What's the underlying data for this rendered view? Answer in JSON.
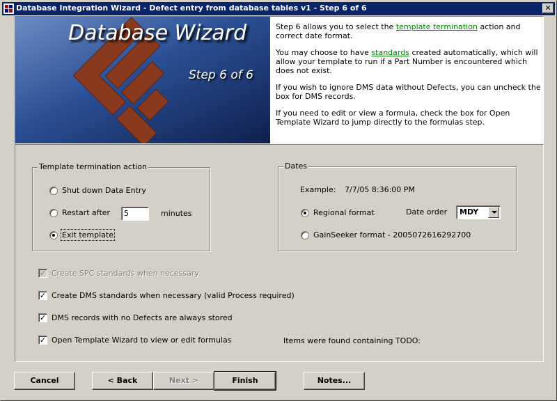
{
  "window": {
    "title": "Database Integration Wizard - Defect entry from database tables    v1 - Step 6 of 6",
    "close_glyph": "✕"
  },
  "banner": {
    "title": "Database Wizard",
    "step": "Step 6 of 6",
    "help": {
      "p1_pre": "Step 6 allows you to select the ",
      "p1_link": "template termination",
      "p1_post": " action and correct date format.",
      "p2_pre": "You may choose to have ",
      "p2_link": "standards",
      "p2_post": " created automatically, which will allow your template to run if a Part Number is encountered which does not exist.",
      "p3": "If you wish to ignore DMS data without Defects, you can uncheck the box for DMS records.",
      "p4": "If you need to edit or view a formula, check the box for Open Template Wizard to jump directly to the formulas step."
    }
  },
  "termination": {
    "legend": "Template termination action",
    "shutdown_label": "Shut down Data Entry",
    "restart_label": "Restart after",
    "restart_minutes_value": "5",
    "minutes_label": "minutes",
    "exit_label": "Exit template",
    "selected": "exit"
  },
  "dates": {
    "legend": "Dates",
    "example_label": "Example:",
    "example_value": "7/7/05 8:36:00 PM",
    "regional_label": "Regional format",
    "date_order_label": "Date order",
    "date_order_value": "MDY",
    "gainseeker_label": "GainSeeker format - 2005072616292700",
    "selected": "regional"
  },
  "options": {
    "spc_standards": {
      "label": "Create SPC standards when necessary",
      "checked": true,
      "enabled": false
    },
    "dms_standards": {
      "label": "Create DMS standards when necessary  (valid Process required)",
      "checked": true,
      "enabled": true
    },
    "dms_records": {
      "label": "DMS records with no Defects are always stored",
      "checked": true,
      "enabled": true
    },
    "open_template_wizard": {
      "label": "Open Template Wizard to view or edit formulas",
      "checked": true,
      "enabled": true
    },
    "todo_notice": "Items were found containing TODO:"
  },
  "buttons": {
    "cancel": "Cancel",
    "back": "< Back",
    "next": "Next >",
    "finish": "Finish",
    "notes": "Notes..."
  },
  "colors": {
    "titlebar": "#0a246a",
    "face": "#d4d0c8",
    "link": "#008000",
    "banner_bg": "#1c3a78",
    "logo_brown": "#8a3a1e"
  }
}
